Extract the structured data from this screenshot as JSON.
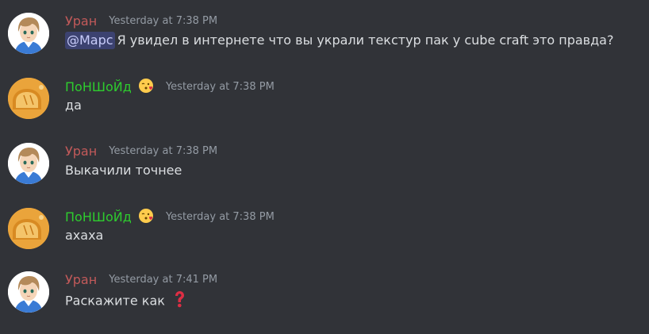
{
  "colors": {
    "background": "#313338",
    "uran_name": "#c35a5a",
    "ponshoid_name": "#2ecc2e",
    "timestamp": "#949ba4",
    "text": "#dbdee1",
    "mention_bg": "#3c4270",
    "mention_text": "#c9cdfb"
  },
  "messages": [
    {
      "author": "Уран",
      "timestamp": "Yesterday at 7:38 PM",
      "mention": "@Марс",
      "text": "Я увидел в интернете что вы украли текстур пак у cube craft это правда?"
    },
    {
      "author": "ПоНШоЙд",
      "author_emoji": "kissing-heart-emoji",
      "timestamp": "Yesterday at 7:38 PM",
      "text": "да"
    },
    {
      "author": "Уран",
      "timestamp": "Yesterday at 7:38 PM",
      "text": "Выкачили точнее"
    },
    {
      "author": "ПоНШоЙд",
      "author_emoji": "kissing-heart-emoji",
      "timestamp": "Yesterday at 7:38 PM",
      "text": "ахаха"
    },
    {
      "author": "Уран",
      "timestamp": "Yesterday at 7:41 PM",
      "text": "Раскажите как",
      "trailing_emoji": "red-question-mark-emoji"
    }
  ]
}
